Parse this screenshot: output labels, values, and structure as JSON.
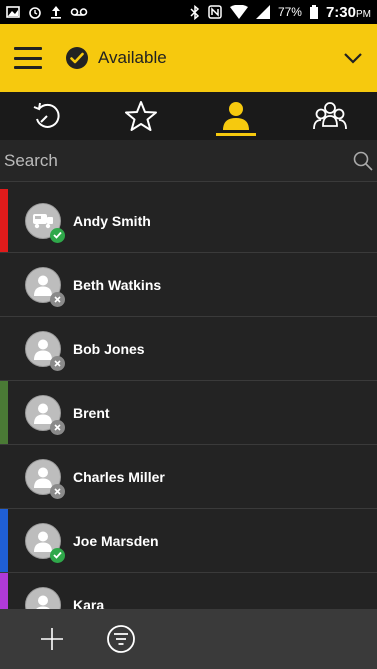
{
  "status_bar": {
    "battery": "77%",
    "time": "7:30",
    "ampm": "PM"
  },
  "header": {
    "presence_label": "Available"
  },
  "tabs": [
    {
      "name": "recent",
      "icon": "history-icon",
      "active": false
    },
    {
      "name": "favorites",
      "icon": "star-icon",
      "active": false
    },
    {
      "name": "contacts",
      "icon": "person-icon",
      "active": true
    },
    {
      "name": "groups",
      "icon": "group-icon",
      "active": false
    }
  ],
  "search": {
    "placeholder": "Search"
  },
  "contacts": [
    {
      "name": "Andy Smith",
      "presence": "available",
      "avatar": "device-avatar-icon",
      "accent": "#e01b1b"
    },
    {
      "name": "Beth Watkins",
      "presence": "offline",
      "avatar": "person-avatar-icon",
      "accent": ""
    },
    {
      "name": "Bob Jones",
      "presence": "offline",
      "avatar": "person-avatar-icon",
      "accent": ""
    },
    {
      "name": "Brent",
      "presence": "offline",
      "avatar": "person-avatar-icon",
      "accent": "#4a7a35"
    },
    {
      "name": "Charles Miller",
      "presence": "offline",
      "avatar": "person-avatar-icon",
      "accent": ""
    },
    {
      "name": "Joe Marsden",
      "presence": "available",
      "avatar": "person-avatar-icon",
      "accent": "#1f5fd6"
    },
    {
      "name": "Kara",
      "presence": "offline",
      "avatar": "person-avatar-icon",
      "accent": "#b03ad8"
    }
  ],
  "colors": {
    "brand_yellow": "#f6c90e",
    "available_green": "#2fa84a",
    "offline_gray": "#8a8a8a"
  },
  "bottom_bar": {
    "add_icon": "plus-icon",
    "filter_icon": "filter-icon"
  }
}
